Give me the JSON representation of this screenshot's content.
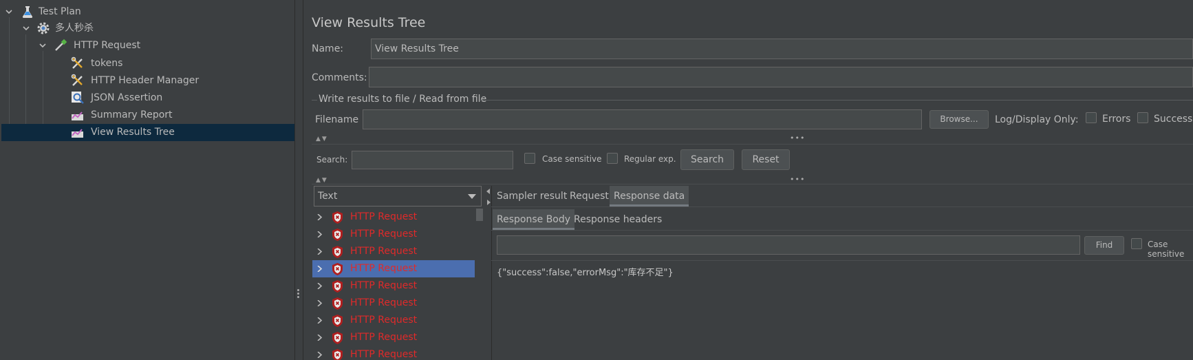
{
  "tree": {
    "items": [
      {
        "label": "Test Plan"
      },
      {
        "label": "多人秒杀"
      },
      {
        "label": "HTTP Request"
      },
      {
        "label": "tokens"
      },
      {
        "label": "HTTP Header Manager"
      },
      {
        "label": "JSON Assertion"
      },
      {
        "label": "Summary Report"
      },
      {
        "label": "View Results Tree"
      }
    ]
  },
  "panel": {
    "title": "View Results Tree",
    "name_label": "Name:",
    "name_value": "View Results Tree",
    "comments_label": "Comments:",
    "comments_value": "",
    "file_group_title": "Write results to file / Read from file",
    "filename_label": "Filename",
    "filename_value": "",
    "browse_label": "Browse...",
    "log_display_label": "Log/Display Only:",
    "errors_label": "Errors",
    "successes_label": "Successes",
    "search_label": "Search:",
    "search_value": "",
    "case_sensitive_label": "Case sensitive",
    "regex_label": "Regular exp.",
    "search_button": "Search",
    "reset_button": "Reset"
  },
  "results": {
    "renderer_selected": "Text",
    "items": [
      {
        "label": "HTTP Request",
        "status": "error"
      },
      {
        "label": "HTTP Request",
        "status": "error"
      },
      {
        "label": "HTTP Request",
        "status": "error"
      },
      {
        "label": "HTTP Request",
        "status": "error",
        "selected": true
      },
      {
        "label": "HTTP Request",
        "status": "error"
      },
      {
        "label": "HTTP Request",
        "status": "error"
      },
      {
        "label": "HTTP Request",
        "status": "error"
      },
      {
        "label": "HTTP Request",
        "status": "error"
      },
      {
        "label": "HTTP Request",
        "status": "error"
      }
    ]
  },
  "detail": {
    "tabs": [
      "Sampler result",
      "Request",
      "Response data"
    ],
    "active_tab": "Response data",
    "subtabs": [
      "Response Body",
      "Response headers"
    ],
    "active_subtab": "Response Body",
    "find_value": "",
    "find_button": "Find",
    "find_case_label": "Case sensitive",
    "response_body": "{\"success\":false,\"errorMsg\":\"库存不足\"}"
  },
  "colors": {
    "background": "#3c3f41",
    "selection": "#0d293e",
    "list_selection": "#4b6eaf",
    "error_text": "#e02a2a"
  }
}
